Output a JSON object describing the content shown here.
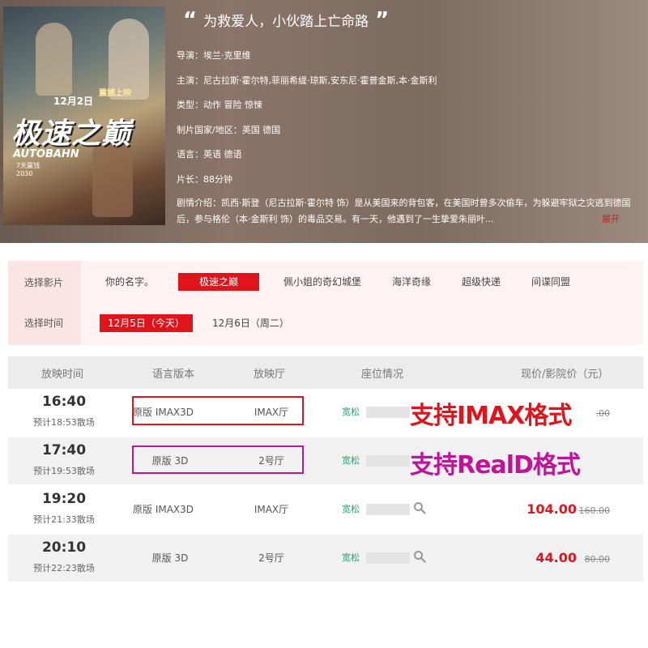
{
  "movie": {
    "poster": {
      "title_text": "极速之巅",
      "english_title": "AUTOBAHN",
      "date_text": "12月2日",
      "date_note": "震撼上映",
      "small_text": "7天赢钱 2030"
    },
    "tagline": "为救爱人，小伙踏上亡命路",
    "quote_open": "“",
    "quote_close": "”",
    "director": "导演：埃兰·克里维",
    "cast": "主演：尼古拉斯·霍尔特,菲丽希缇·琼斯,安东尼·霍普金斯,本·金斯利",
    "genre": "类型：动作 冒险 惊悚",
    "country": "制片国家/地区：英国 德国",
    "language": "语言：英语 德语",
    "runtime": "片长：88分钟",
    "synopsis": "剧情介绍：凯西·斯登（尼古拉斯·霍尔特 饰）是从美国来的背包客，在美国时曾多次偷车，为躲避牢狱之灾逃到德国后，参与格伦（本·金斯利 饰）的毒品交易。有一天，他遇到了一生挚爱朱丽叶...",
    "expand_label": "展开"
  },
  "filter": {
    "film_label": "选择影片",
    "time_label": "选择时间",
    "films": [
      "你的名字。",
      "极速之巅",
      "佩小姐的奇幻城堡",
      "海洋奇缘",
      "超级快递",
      "间谍同盟"
    ],
    "selected_film": "极速之巅",
    "dates": [
      "12月5日（今天）",
      "12月6日（周二）"
    ],
    "selected_date": "12月5日（今天）"
  },
  "table": {
    "headers": {
      "time": "放映时间",
      "lang": "语言版本",
      "hall": "放映厅",
      "seat": "座位情况",
      "price": "现价/影院价（元）"
    },
    "rows": [
      {
        "time": "16:40",
        "end": "预计18:53散场",
        "lang": "原版 IMAX3D",
        "hall": "IMAX厅",
        "seat": "宽松",
        "price": "",
        "orig": ".00"
      },
      {
        "time": "17:40",
        "end": "预计19:53散场",
        "lang": "原版 3D",
        "hall": "2号厅",
        "seat": "宽松",
        "price": "",
        "orig": ""
      },
      {
        "time": "19:20",
        "end": "预计21:33散场",
        "lang": "原版 IMAX3D",
        "hall": "IMAX厅",
        "seat": "宽松",
        "price": "104.00",
        "orig": "160.00"
      },
      {
        "time": "20:10",
        "end": "预计22:23散场",
        "lang": "原版 3D",
        "hall": "2号厅",
        "seat": "宽松",
        "price": "44.00",
        "orig": "80.00"
      }
    ]
  },
  "annotations": {
    "imax": "支持IMAX格式",
    "reald": "支持RealD格式",
    "imax_color": "#e0151c",
    "reald_color": "#c0139a"
  },
  "colors": {
    "accent": "#e0151c",
    "seat_green": "#1aa36b",
    "filter_bg": "#fff2f2"
  }
}
